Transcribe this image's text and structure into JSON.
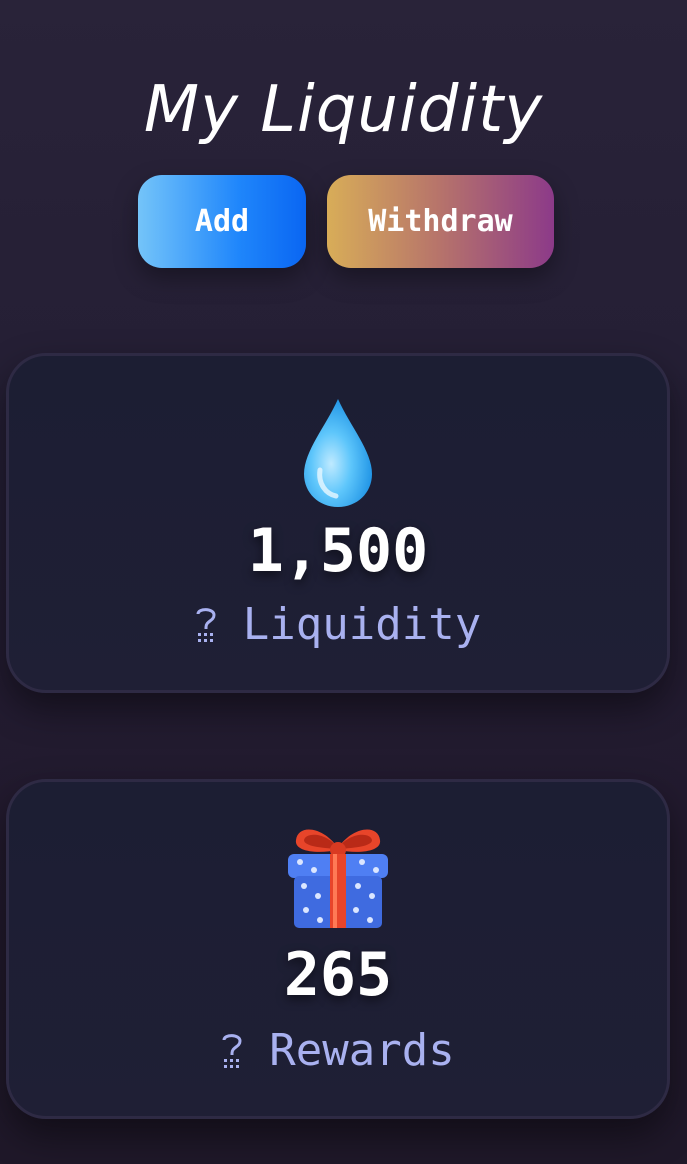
{
  "page": {
    "title": "My Liquidity"
  },
  "actions": {
    "add_label": "Add",
    "withdraw_label": "Withdraw"
  },
  "cards": {
    "liquidity": {
      "icon": "water-drop-icon",
      "value": "1,500",
      "label": "Liquidity"
    },
    "rewards": {
      "icon": "gift-icon",
      "value": "265",
      "label": "Rewards"
    }
  },
  "colors": {
    "background": "#251e34",
    "card": "#1e1f34",
    "label": "#a9b1f0",
    "add_gradient_start": "#74c4f9",
    "add_gradient_end": "#0a66f2",
    "withdraw_gradient_start": "#d8ad58",
    "withdraw_gradient_end": "#8c3a89"
  }
}
